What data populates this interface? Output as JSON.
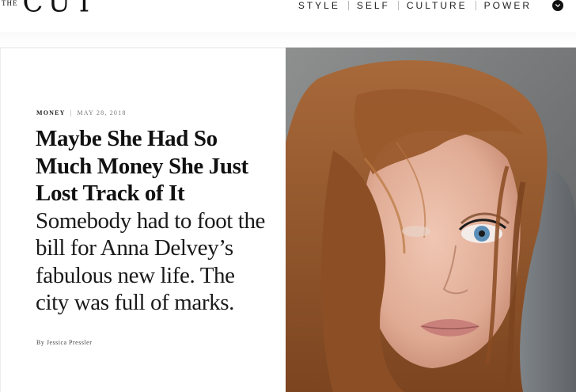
{
  "logo": {
    "small": "THE",
    "word": "CUT"
  },
  "nav": {
    "items": [
      {
        "label": "STYLE"
      },
      {
        "label": "SELF"
      },
      {
        "label": "CULTURE"
      },
      {
        "label": "POWER"
      }
    ]
  },
  "article": {
    "rubric": "MONEY",
    "separator": "|",
    "date": "MAY 28, 2018",
    "headline": "Maybe She Had So Much Money She Just Lost Track of It",
    "dek": "Somebody had to foot the bill for Anna Delvey’s fabulous new life. The city was full of marks.",
    "byline": "By Jessica Pressler"
  },
  "colors": {
    "text": "#111111",
    "nav_toggle": "#111111",
    "hair": "#9b5a2a",
    "skin": "#e6b8a2",
    "eye": "#5c8fb8",
    "car_seat": "#7a7f84"
  },
  "icons": {
    "nav_toggle": "chevron-down-icon"
  }
}
